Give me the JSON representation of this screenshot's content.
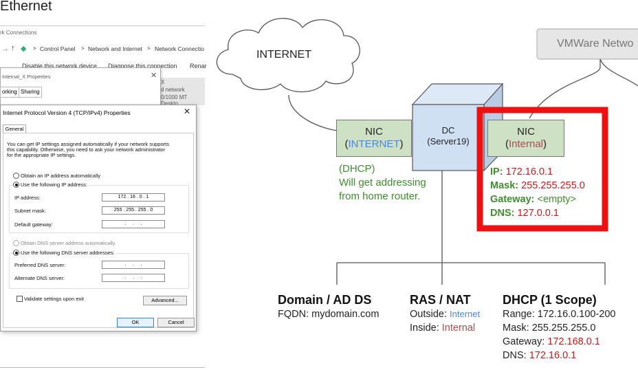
{
  "window": {
    "title": "Ethernet"
  },
  "explorer": {
    "window_title_fragment": "rk Connections",
    "breadcrumb": [
      "Control Panel",
      "Network and Internet",
      "Network Connectio"
    ],
    "commands": [
      "Disable this network device",
      "Diagnose this connection",
      "Renar"
    ],
    "bg_row": [
      "X",
      "d network",
      "0/1000 MT Deskto"
    ]
  },
  "properties": {
    "title": "Internal_X Properties",
    "tabs": [
      "orking",
      "Sharing"
    ]
  },
  "ipv4_dialog": {
    "title": "Internet Protocol Version 4 (TCP/IPv4) Properties",
    "tab": "General",
    "intro": [
      "You can get IP settings assigned automatically if your network supports",
      "this capability. Otherwise, you need to ask your network administrator",
      "for the appropriate IP settings."
    ],
    "ip_auto_label": "Obtain an IP address automatically",
    "ip_manual_label": "Use the following IP address:",
    "ip_address_label": "IP address:",
    "ip_address_value": "172 . 16 . 0 . 1",
    "subnet_label": "Subnet mask:",
    "subnet_value": "255 . 255 . 255 . 0",
    "gateway_label": "Default gateway:",
    "gateway_value": "  .     .     .  ",
    "dns_auto_label": "Obtain DNS server address automatically",
    "dns_manual_label": "Use the following DNS server addresses:",
    "preferred_dns_label": "Preferred DNS server:",
    "preferred_dns_value": "  .     .     .  ",
    "alternate_dns_label": "Alternate DNS server:",
    "alternate_dns_value": "  .     .     .  ",
    "validate_label": "Validate settings upon exit",
    "advanced_label": "Advanced...",
    "ok_label": "OK",
    "cancel_label": "Cancel"
  },
  "diagram": {
    "internet_cloud": "INTERNET",
    "vmware": "VMWare Netwo",
    "nic_left": {
      "title": "NIC",
      "sub": "INTERNET"
    },
    "dc": {
      "title": "DC",
      "sub": "(Server19)"
    },
    "nic_right": {
      "title": "NIC",
      "sub": "Internal"
    },
    "dhcp_note": [
      "(DHCP)",
      "Will get addressing",
      "from home router."
    ],
    "config": {
      "ip_key": "IP:",
      "ip_val": "172.16.0.1",
      "mask_key": "Mask:",
      "mask_val": "255.255.255.0",
      "gw_key": "Gateway:",
      "gw_val": "<empty>",
      "dns_key": "DNS:",
      "dns_val": "127.0.0.1"
    },
    "roles": {
      "domain": {
        "head": "Domain / AD DS",
        "line": "FQDN: mydomain.com"
      },
      "ras": {
        "head": "RAS / NAT",
        "out_key": "Outside:",
        "out_val": "Internet",
        "in_key": "Inside:",
        "in_val": "Internal"
      },
      "dhcp": {
        "head": "DHCP (1 Scope)",
        "range": "Range: 172.16.0.100-200",
        "mask": "Mask: 255.255.255.0",
        "gw_key": "Gateway:",
        "gw_val": "172.168.0.1",
        "dns_key": "DNS:",
        "dns_val": "172.16.0.1"
      }
    }
  },
  "colors": {
    "highlight_red": "#ee1111",
    "nic_green": "#cfe1c4",
    "server_blue": "#cfe0f3",
    "link_blue": "#4a86e8",
    "text_red": "#c41c1c",
    "text_green": "#3e8e2e"
  }
}
